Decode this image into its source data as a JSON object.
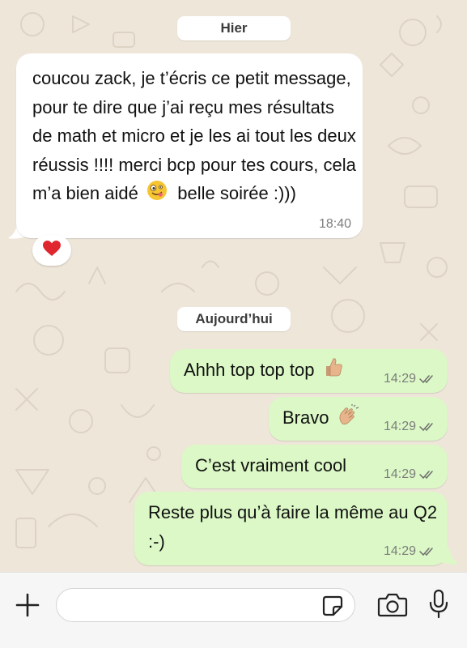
{
  "chat": {
    "date_separator_yesterday": "Hier",
    "date_separator_today": "Aujourd’hui",
    "incoming_message": {
      "text": "coucou zack, je t’écris ce petit message, pour te dire que j’ai reçu mes résultats de math et micro et je les ai tout les deux réussis !!!! merci bcp pour tes cours, cela m’a bien aidé",
      "text_after_emoji": "belle soirée :)))",
      "emoji": "zany-face-icon",
      "time": "18:40",
      "reaction": "red-heart-icon"
    },
    "outgoing_messages": [
      {
        "text": "Ahhh top top top",
        "emoji": "thumbs-up-icon",
        "time": "14:29",
        "status": "read-double-check-icon"
      },
      {
        "text": "Bravo",
        "emoji": "clapping-hands-icon",
        "time": "14:29",
        "status": "read-double-check-icon"
      },
      {
        "text": "C’est vraiment cool",
        "emoji": "",
        "time": "14:29",
        "status": "read-double-check-icon"
      },
      {
        "text": "Reste plus qu’à faire la même au Q2 :-)",
        "emoji": "",
        "time": "14:29",
        "status": "read-double-check-icon"
      }
    ]
  },
  "input_bar": {
    "message_value": "",
    "icons": [
      "plus-icon",
      "sticker-icon",
      "camera-icon",
      "microphone-icon"
    ]
  },
  "colors": {
    "chat_background": "#efe6da",
    "incoming_bubble": "#ffffff",
    "outgoing_bubble": "#dbf8c6",
    "timestamp": "#7d7d7d",
    "read_check": "#6e6e6e",
    "heart": "#e0262f"
  }
}
